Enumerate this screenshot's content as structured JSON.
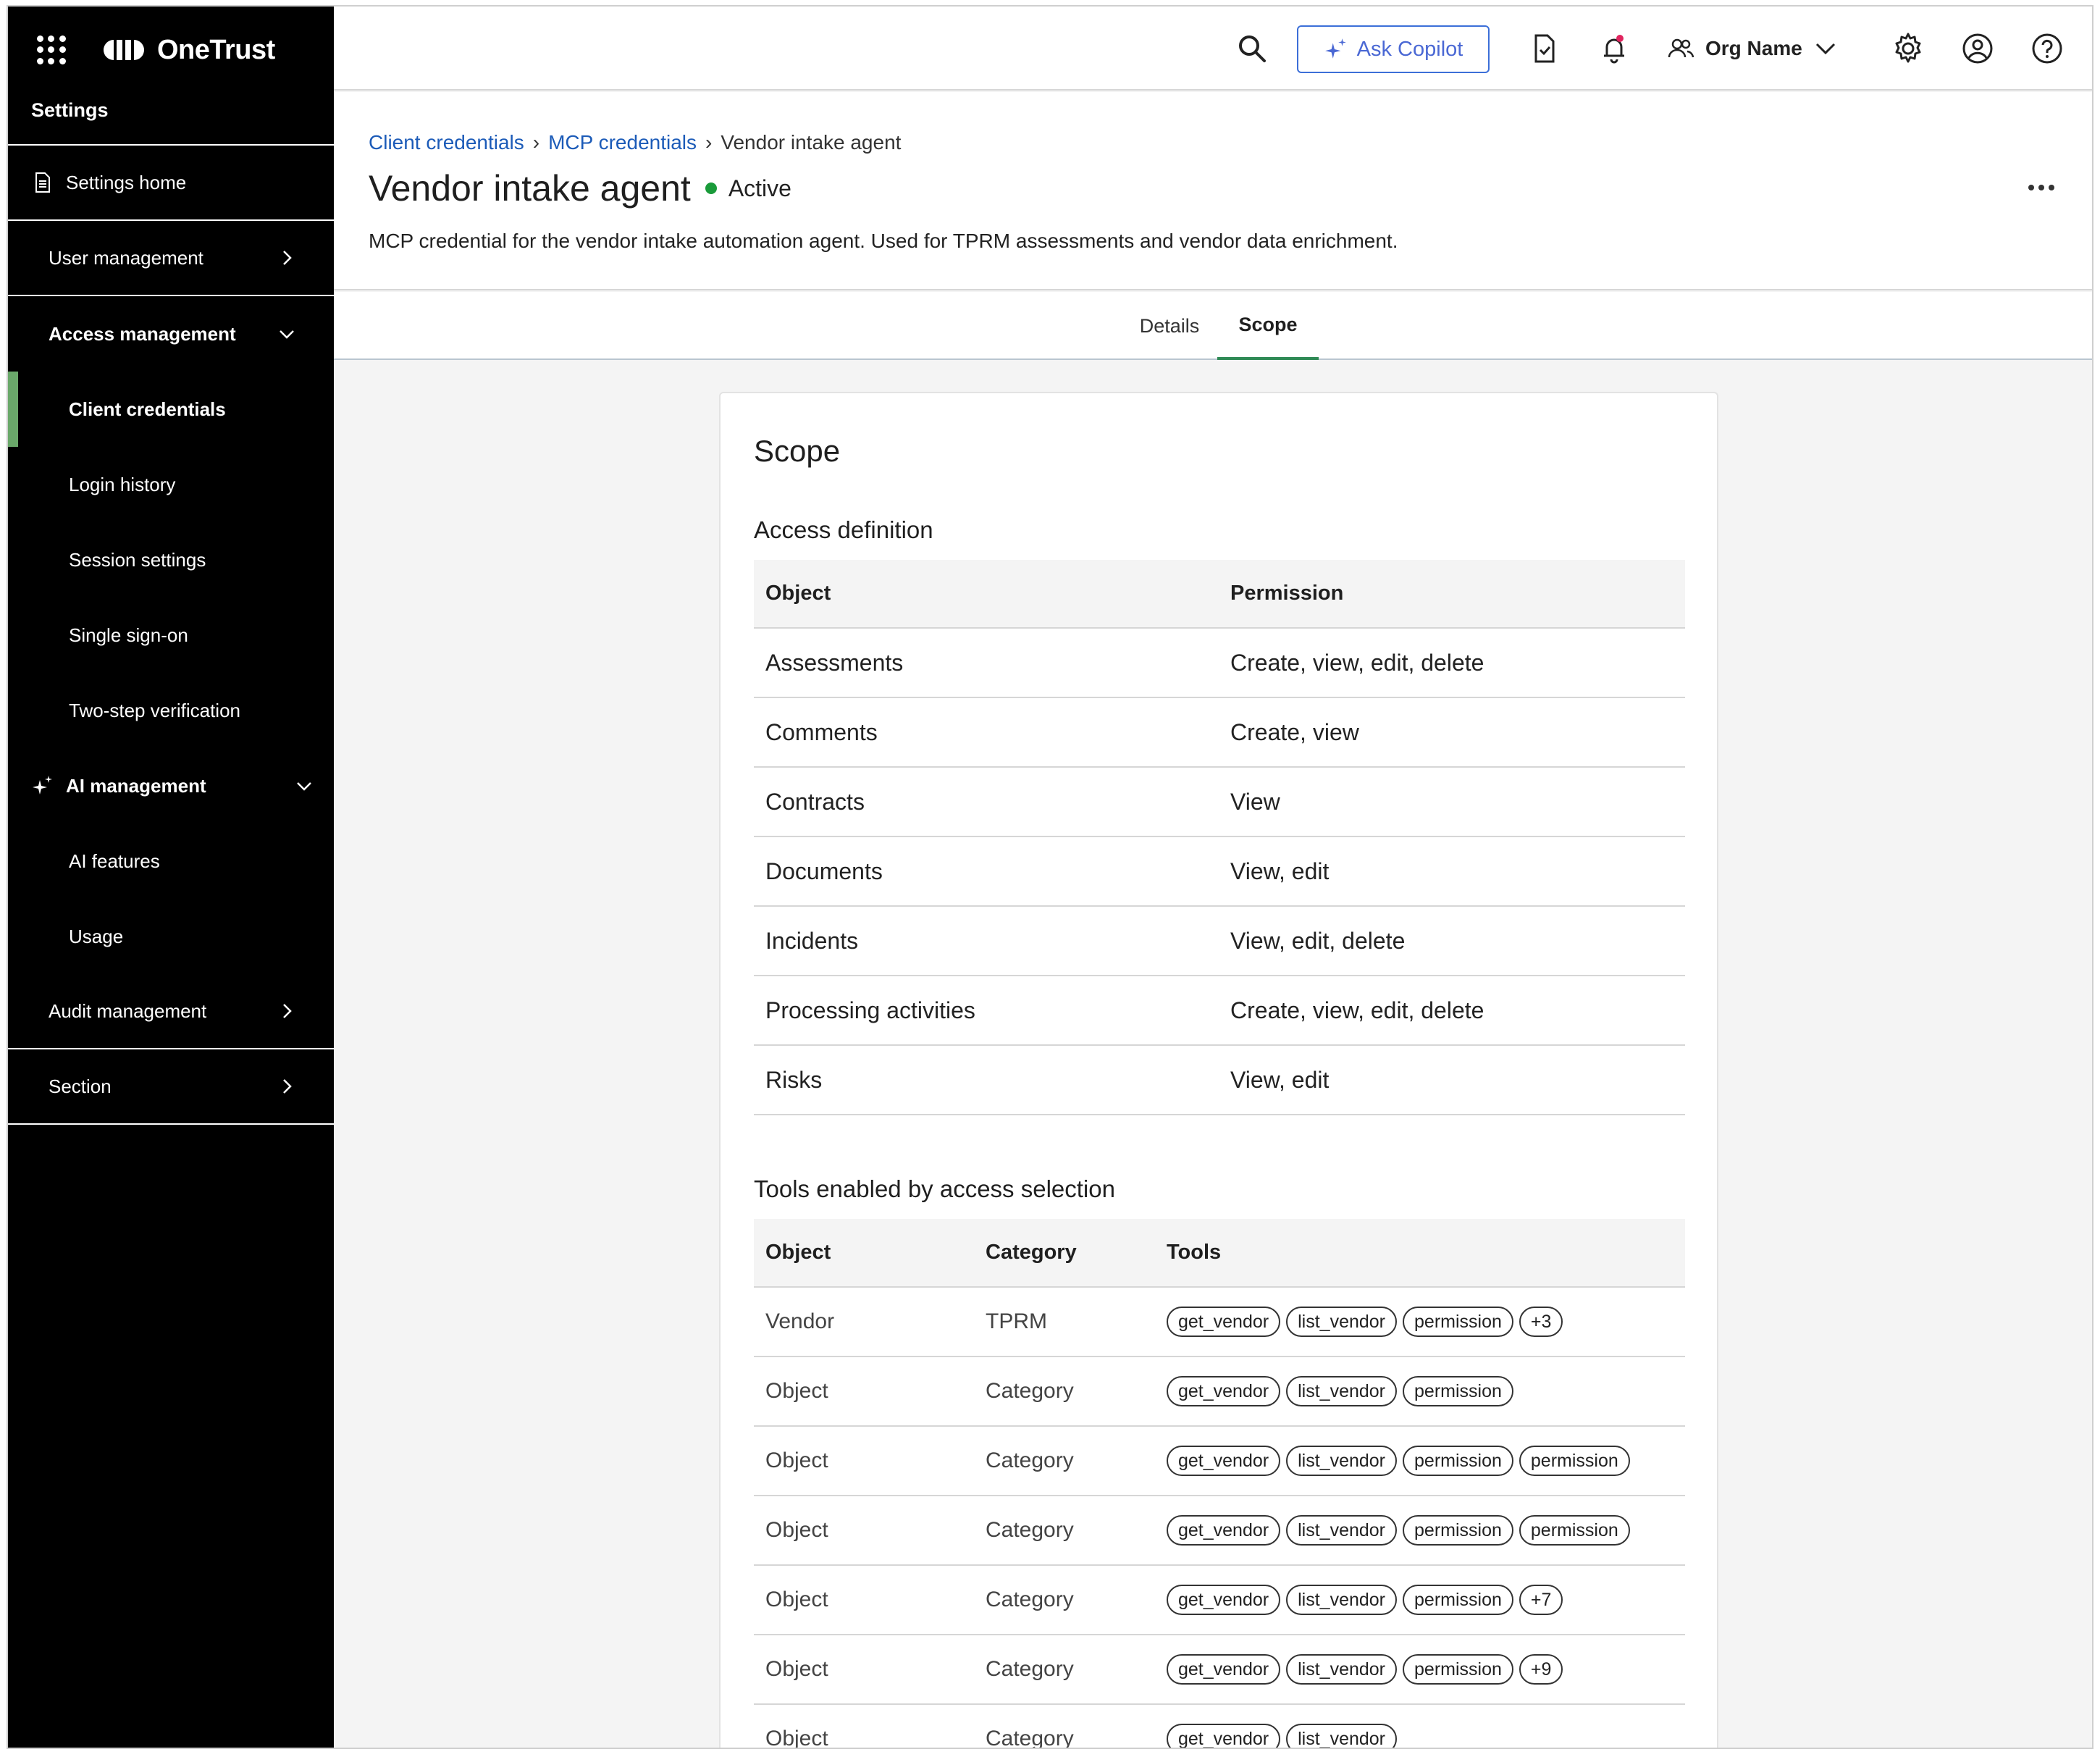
{
  "app": {
    "brand": "OneTrust"
  },
  "sidebar": {
    "section_title": "Settings",
    "settings_home": "Settings home",
    "user_management": "User management",
    "access_management": "Access management",
    "access_children": [
      "Client credentials",
      "Login history",
      "Session settings",
      "Single sign-on",
      "Two-step verification"
    ],
    "ai_management": "AI management",
    "ai_children": [
      "AI features",
      "Usage"
    ],
    "audit_management": "Audit management",
    "section": "Section"
  },
  "topbar": {
    "copilot_label": "Ask Copilot",
    "org_name": "Org Name"
  },
  "breadcrumb": [
    "Client credentials",
    "MCP credentials",
    "Vendor intake agent"
  ],
  "page": {
    "title": "Vendor intake agent",
    "status": "Active",
    "description": "MCP credential for the vendor intake automation agent. Used for TPRM assessments and vendor data enrichment."
  },
  "tabs": [
    "Details",
    "Scope"
  ],
  "card": {
    "title": "Scope",
    "access_heading": "Access definition",
    "access_columns": [
      "Object",
      "Permission"
    ],
    "access_rows": [
      [
        "Assessments",
        "Create, view, edit, delete"
      ],
      [
        "Comments",
        "Create, view"
      ],
      [
        "Contracts",
        "View"
      ],
      [
        "Documents",
        "View, edit"
      ],
      [
        "Incidents",
        "View, edit, delete"
      ],
      [
        "Processing activities",
        "Create, view, edit, delete"
      ],
      [
        "Risks",
        "View, edit"
      ]
    ],
    "tools_heading": "Tools enabled by access selection",
    "tools_columns": [
      "Object",
      "Category",
      "Tools"
    ],
    "tools_rows": [
      {
        "object": "Vendor",
        "category": "TPRM",
        "tools": [
          "get_vendor",
          "list_vendor",
          "permission",
          "+3"
        ]
      },
      {
        "object": "Object",
        "category": "Category",
        "tools": [
          "get_vendor",
          "list_vendor",
          "permission"
        ]
      },
      {
        "object": "Object",
        "category": "Category",
        "tools": [
          "get_vendor",
          "list_vendor",
          "permission",
          "permission"
        ]
      },
      {
        "object": "Object",
        "category": "Category",
        "tools": [
          "get_vendor",
          "list_vendor",
          "permission",
          "permission"
        ]
      },
      {
        "object": "Object",
        "category": "Category",
        "tools": [
          "get_vendor",
          "list_vendor",
          "permission",
          "+7"
        ]
      },
      {
        "object": "Object",
        "category": "Category",
        "tools": [
          "get_vendor",
          "list_vendor",
          "permission",
          "+9"
        ]
      },
      {
        "object": "Object",
        "category": "Category",
        "tools": [
          "get_vendor",
          "list_vendor"
        ]
      }
    ]
  }
}
